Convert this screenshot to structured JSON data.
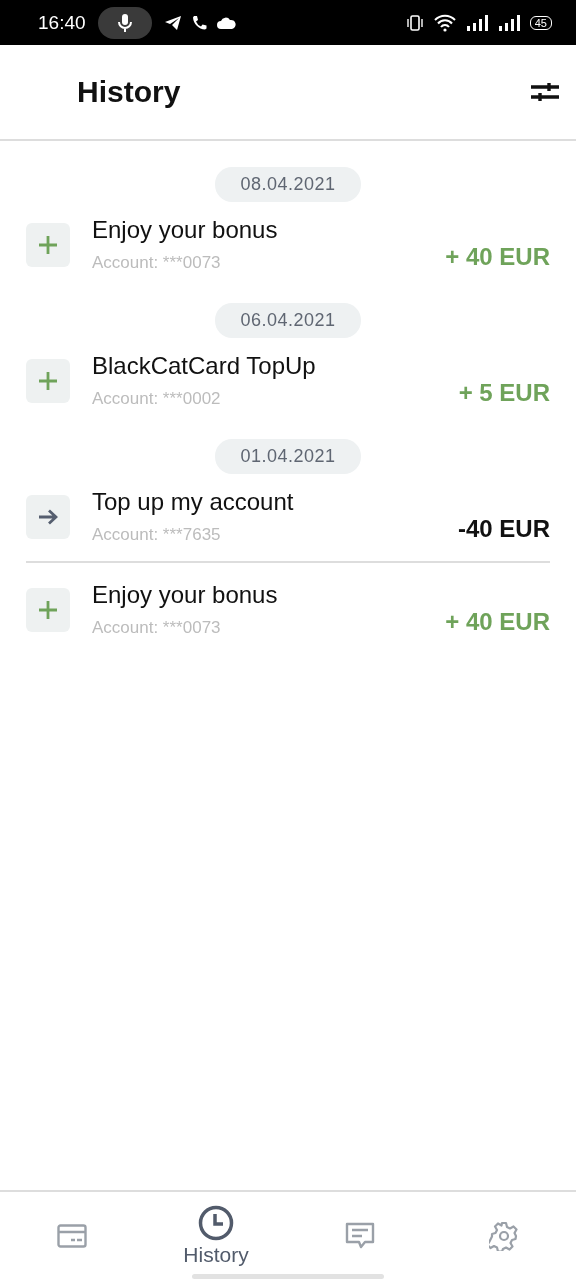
{
  "status_bar": {
    "time": "16:40",
    "battery": "45"
  },
  "header": {
    "title": "History"
  },
  "groups": [
    {
      "date": "08.04.2021",
      "transactions": [
        {
          "kind": "in",
          "title": "Enjoy your bonus",
          "account": "Account: ***0073",
          "amount": "+ 40 EUR"
        }
      ]
    },
    {
      "date": "06.04.2021",
      "transactions": [
        {
          "kind": "in",
          "title": "BlackCatCard TopUp",
          "account": "Account: ***0002",
          "amount": "+ 5 EUR"
        }
      ]
    },
    {
      "date": "01.04.2021",
      "transactions": [
        {
          "kind": "out",
          "title": "Top up my account",
          "account": "Account: ***7635",
          "amount": "-40 EUR"
        },
        {
          "kind": "in",
          "title": "Enjoy your bonus",
          "account": "Account: ***0073",
          "amount": "+ 40 EUR"
        }
      ]
    }
  ],
  "nav": [
    {
      "kind": "card",
      "selected": false
    },
    {
      "kind": "history",
      "label": "History",
      "selected": true
    },
    {
      "kind": "chat",
      "selected": false
    },
    {
      "kind": "settings",
      "selected": false
    }
  ]
}
